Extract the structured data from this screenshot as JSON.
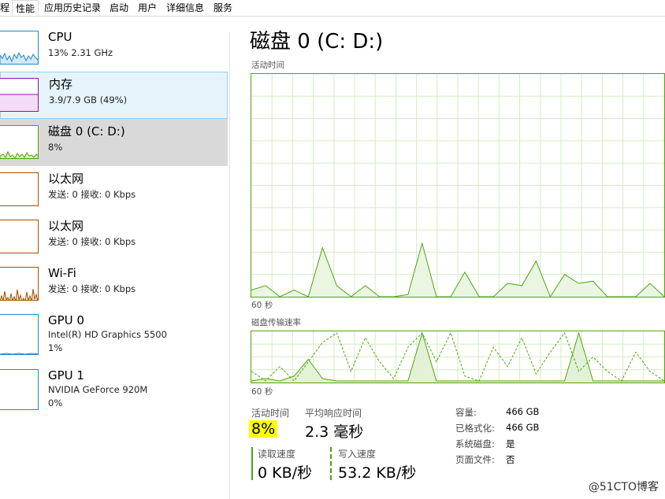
{
  "tabs": [
    "程",
    "性能",
    "应用历史记录",
    "启动",
    "用户",
    "详细信息",
    "服务"
  ],
  "sidebar": {
    "items": [
      {
        "title": "CPU",
        "lines": [
          "13% 2.31 GHz"
        ]
      },
      {
        "title": "内存",
        "lines": [
          "3.9/7.9 GB (49%)"
        ]
      },
      {
        "title": "磁盘 0 (C: D:)",
        "lines": [
          "8%"
        ]
      },
      {
        "title": "以太网",
        "lines": [
          "发送: 0 接收: 0 Kbps"
        ]
      },
      {
        "title": "以太网",
        "lines": [
          "发送: 0 接收: 0 Kbps"
        ]
      },
      {
        "title": "Wi-Fi",
        "lines": [
          "发送: 0 接收: 0 Kbps"
        ]
      },
      {
        "title": "GPU 0",
        "lines": [
          "Intel(R) HD Graphics 5500",
          "1%"
        ]
      },
      {
        "title": "GPU 1",
        "lines": [
          "NVIDIA GeForce 920M",
          "0%"
        ]
      }
    ]
  },
  "main": {
    "title": "磁盘 0 (C: D:)",
    "chart1_label": "活动时间",
    "chart1_time": "60 秒",
    "chart2_label": "磁盘传输速率",
    "chart2_time": "60 秒",
    "active_time_label": "活动时间",
    "active_time_value": "8%",
    "response_label": "平均响应时间",
    "response_value": "2.3 毫秒",
    "read_label": "读取速度",
    "read_value": "0 KB/秒",
    "write_label": "写入速度",
    "write_value": "53.2 KB/秒"
  },
  "properties": [
    {
      "key": "容量:",
      "value": "466 GB"
    },
    {
      "key": "已格式化:",
      "value": "466 GB"
    },
    {
      "key": "系统磁盘:",
      "value": "是"
    },
    {
      "key": "页面文件:",
      "value": "否"
    }
  ],
  "watermark": "@51CTO博客",
  "colors": {
    "disk_green": "#4da60c",
    "memory_purple": "#8b12ae",
    "cpu_blue": "#1f89c9",
    "ethernet_brown": "#a74f01",
    "gpu_blue": "#1f89c9",
    "selected_bg": "#d9d9d9",
    "hover_bg": "#e5f3fb",
    "highlight": "#ffff00"
  },
  "chart_data": [
    {
      "type": "area",
      "series": [
        {
          "values": [
            3,
            5,
            0,
            3,
            0,
            22,
            5,
            0,
            5,
            0,
            0,
            1,
            24,
            0,
            0,
            11,
            0,
            0,
            6,
            5,
            16,
            0,
            10,
            6,
            7,
            0,
            0,
            0,
            6,
            0
          ]
        }
      ]
    },
    {
      "type": "line",
      "series": [
        {
          "values": [
            20,
            0,
            30,
            0,
            40,
            80,
            100,
            20,
            90,
            40,
            5,
            70,
            100,
            40,
            100,
            10,
            0,
            70,
            30,
            90,
            15,
            60,
            100,
            20,
            50,
            20,
            0,
            60,
            20,
            0
          ]
        },
        {
          "values": [
            0,
            5,
            0,
            10,
            45,
            5,
            0,
            0,
            0,
            0,
            0,
            0,
            100,
            0,
            0,
            0,
            0,
            0,
            0,
            0,
            0,
            0,
            0,
            100,
            0,
            0,
            0,
            0,
            0,
            0
          ]
        }
      ]
    }
  ]
}
